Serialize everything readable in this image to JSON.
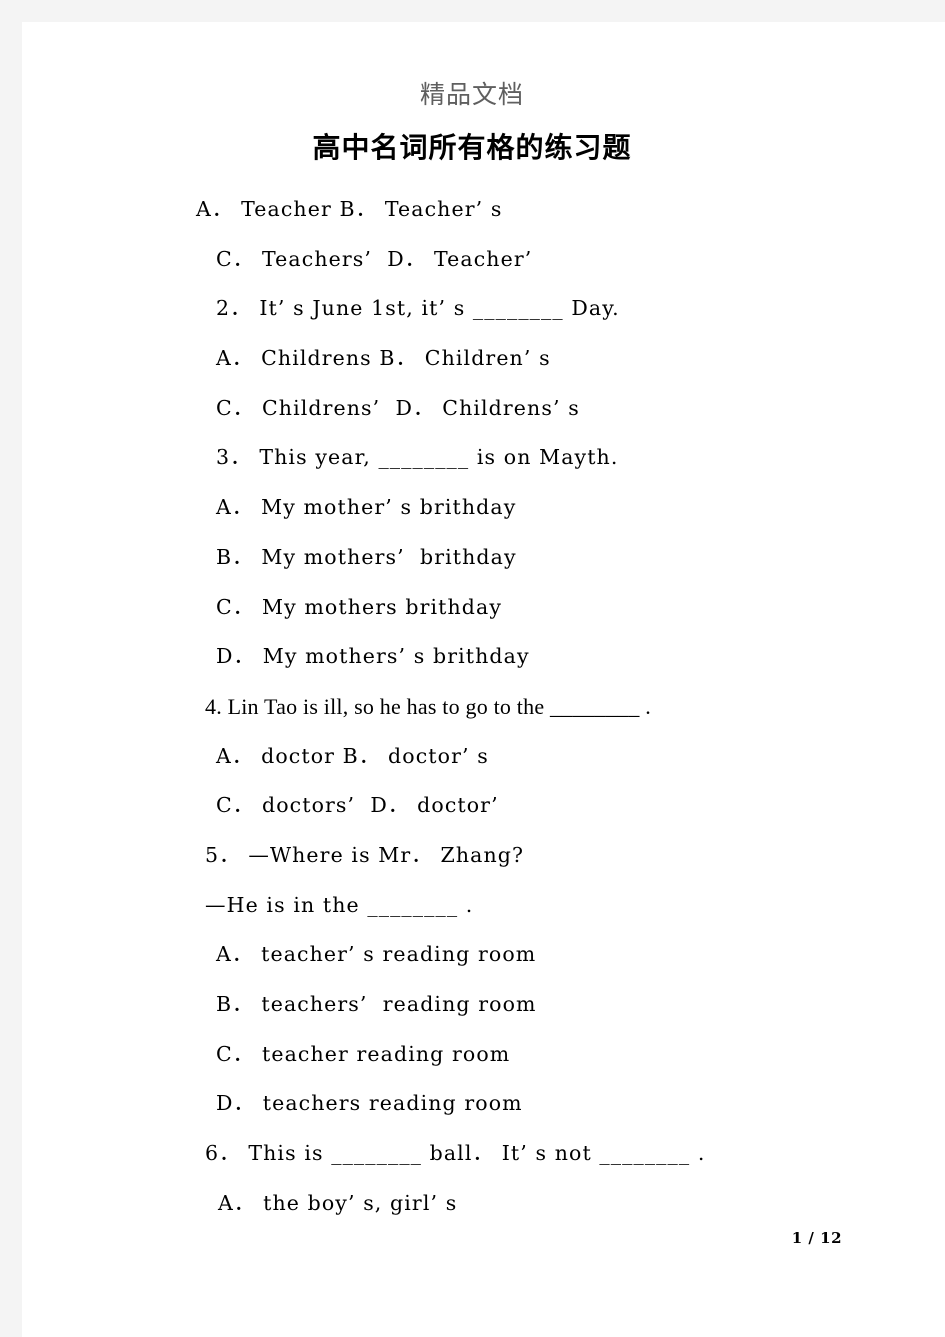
{
  "page": {
    "header_text": "精品文档",
    "title": "高中名词所有格的练习题",
    "footer": "1 / 12",
    "colors": {
      "page_background": "#ffffff",
      "margin_band": "#f4f4f4",
      "header_text": "#5f5f5f",
      "body_text": "#000000"
    }
  },
  "body": {
    "lines": [
      {
        "text": "A． Teacher B． Teacher’ s",
        "indent": "a",
        "style": "wide"
      },
      {
        "text": "C． Teachers’  D． Teacher’",
        "indent": "c",
        "style": "wide"
      },
      {
        "text": "2． It’ s June 1st, it’ s ________ Day.",
        "indent": "c",
        "style": "wide"
      },
      {
        "text": "A． Childrens B． Children’ s",
        "indent": "c",
        "style": "wide"
      },
      {
        "text": "C． Childrens’  D． Childrens’ s",
        "indent": "c",
        "style": "wide"
      },
      {
        "text": "3． This year, ________ is on Mayth.",
        "indent": "c",
        "style": "wide"
      },
      {
        "text": "A． My mother’ s brithday",
        "indent": "c",
        "style": "wide"
      },
      {
        "text": "B． My mothers’  brithday",
        "indent": "c",
        "style": "wide"
      },
      {
        "text": "C． My mothers brithday",
        "indent": "c",
        "style": "wide"
      },
      {
        "text": "D． My mothers’ s brithday",
        "indent": "c",
        "style": "wide"
      },
      {
        "text": "4. Lin Tao is ill, so he has to go to the ________ .",
        "indent": "b",
        "style": "narrow"
      },
      {
        "text": "A． doctor B． doctor’ s",
        "indent": "c",
        "style": "wide"
      },
      {
        "text": "C． doctors’  D． doctor’",
        "indent": "c",
        "style": "wide"
      },
      {
        "text": "5． —Where is Mr． Zhang?",
        "indent": "b",
        "style": "wide"
      },
      {
        "text": "—He is in the ________ .",
        "indent": "b",
        "style": "wide"
      },
      {
        "text": "A． teacher’ s reading room",
        "indent": "c",
        "style": "wide"
      },
      {
        "text": "B． teachers’  reading room",
        "indent": "c",
        "style": "wide"
      },
      {
        "text": "C． teacher reading room",
        "indent": "c",
        "style": "wide"
      },
      {
        "text": "D． teachers reading room",
        "indent": "c",
        "style": "wide"
      },
      {
        "text": "6． This is ________ ball． It’ s not ________ .",
        "indent": "b",
        "style": "wide"
      },
      {
        "text": "A． the boy’ s, girl’ s",
        "indent": "d",
        "style": "wide"
      }
    ]
  }
}
